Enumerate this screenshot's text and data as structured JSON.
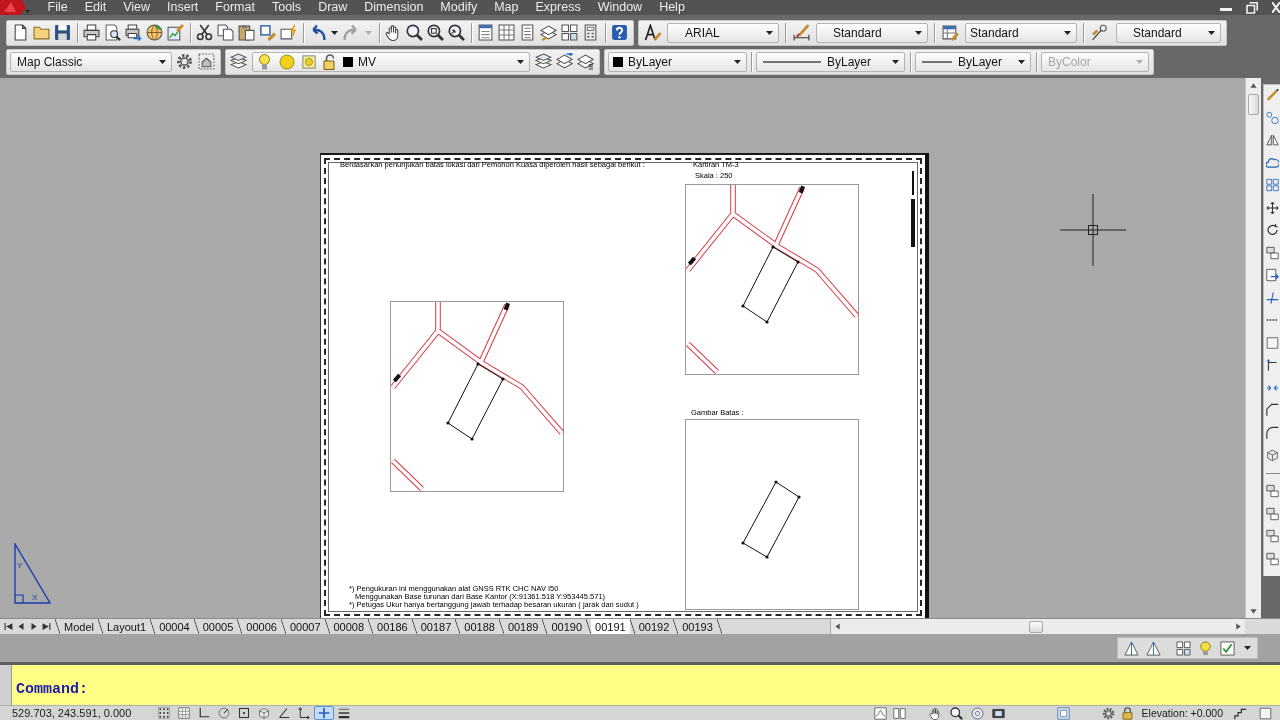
{
  "menu_bar": {
    "items": [
      "File",
      "Edit",
      "View",
      "Insert",
      "Format",
      "Tools",
      "Draw",
      "Dimension",
      "Modify",
      "Map",
      "Express",
      "Window",
      "Help"
    ]
  },
  "styles_toolbar": {
    "text_style": "ARIAL",
    "dimension_style": "Standard",
    "table_style": "Standard",
    "multileader_style": "Standard"
  },
  "workspace_toolbar": {
    "workspace": "Map Classic"
  },
  "layers_toolbar": {
    "layer": "MV",
    "on": true,
    "frozen": false,
    "locked": false
  },
  "properties_toolbar": {
    "color_setting": "ByLayer",
    "linetype": "ByLayer",
    "lineweight": "ByLayer",
    "plot_style": "ByColor",
    "plot_style_disabled": true
  },
  "sheet": {
    "header_note": "Berdasarkan penunjukan batas lokasi dari Pemohon Kuasa diperoleh hasil sebagai berikut :",
    "map_title": "Kartiran TM-3",
    "map_scale": "Skala : 250",
    "boundary_title": "Gambar Batas :",
    "footnotes": [
      {
        "kind": "note",
        "text": "*) Pengukuran ini menggunakan alat GNSS RTK CHC NAV I50"
      },
      {
        "kind": "continuation",
        "text": "Menggunakan Base turunan dari Base Kantor (X:91361.518 Y:953445.571)"
      },
      {
        "kind": "note",
        "text": "*) Petugas Ukur hanya bertanggung jawab terhadap besaran ukuran ( jarak dan sudut )"
      }
    ]
  },
  "ucs_icon": {
    "y_label": "Y",
    "x_label": "X"
  },
  "layout_tabs": [
    {
      "label": "Model",
      "selected": false
    },
    {
      "label": "Layout1",
      "selected": false
    },
    {
      "label": "00004",
      "selected": false
    },
    {
      "label": "00005",
      "selected": false
    },
    {
      "label": "00006",
      "selected": false
    },
    {
      "label": "00007",
      "selected": false
    },
    {
      "label": "00008",
      "selected": false
    },
    {
      "label": "00186",
      "selected": false
    },
    {
      "label": "00187",
      "selected": false
    },
    {
      "label": "00188",
      "selected": false
    },
    {
      "label": "00189",
      "selected": false
    },
    {
      "label": "00190",
      "selected": false
    },
    {
      "label": "00191",
      "selected": true
    },
    {
      "label": "00192",
      "selected": false
    },
    {
      "label": "00193",
      "selected": false
    }
  ],
  "command_line": {
    "prompt": "Command:"
  },
  "status_bar": {
    "coordinates": "529.703, 243.591, 0.000",
    "toggles": [
      {
        "on": false
      },
      {
        "on": false
      },
      {
        "on": false
      },
      {
        "on": false
      },
      {
        "on": false
      },
      {
        "on": false
      },
      {
        "on": false
      },
      {
        "on": false
      },
      {
        "on": true
      },
      {
        "on": false
      }
    ],
    "elevation": "Elevation: +0.000"
  }
}
